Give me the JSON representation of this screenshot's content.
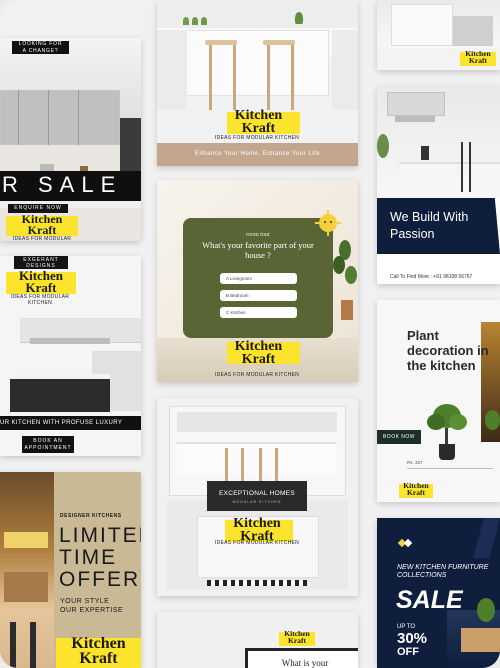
{
  "brand": {
    "name": "Kitchen Kraft",
    "name_line1": "Kitchen",
    "name_line2": "Kraft",
    "tagline": "IDEAS FOR MODULAR KITCHEN"
  },
  "col1": {
    "tile1": {
      "top_label_1": "LOOKING FOR",
      "top_label_2": "A CHANGE?",
      "sale_text": "R SALE",
      "enquire": "ENQUIRE NOW"
    },
    "tile2": {
      "label_1": "EXGERANT",
      "label_2": "DESIGNS",
      "bottom_text": "UR KITCHEN  WITH PROFUSE LUXURY",
      "book_1": "BOOK AN",
      "book_2": "APPOINTMENT"
    },
    "tile3": {
      "small": "DESIGNER KITCHENS",
      "headline_1": "LIMITED",
      "headline_2": "TIME",
      "headline_3": "OFFER",
      "sub_1": "YOUR STYLE",
      "sub_2": "OUR EXPERTISE"
    }
  },
  "col2": {
    "tile1": {
      "caption": "Enhance Your Home, Enhance Your Life"
    },
    "tile2": {
      "room_tour": "room tour",
      "question": "What's your favorite part of your house ?",
      "options": [
        "A  Livingroom",
        "B  Bedroom",
        "C  Kitchen"
      ]
    },
    "tile3": {
      "banner": "EXCEPTIONAL HOMES",
      "banner_sub": "MODULAR KITCHEN"
    },
    "tile4": {
      "question": "What is your"
    }
  },
  "col3": {
    "tile2": {
      "headline_1": "We Build With",
      "headline_2": "Passion",
      "phone": "Call To Find More : +91 98108 56767"
    },
    "tile3": {
      "headline_1": "Plant",
      "headline_2": "decoration in",
      "headline_3": "the kitchen",
      "book": "BOOK NOW",
      "price": "Rs. 337"
    },
    "tile4": {
      "line1": "NEW KITCHEN FURNITURE",
      "line2": "COLLECTIONS",
      "sale": "SALE",
      "upto": "UP TO",
      "percent": "30%",
      "off": "OFF"
    }
  },
  "colors": {
    "yellow": "#fbe42b",
    "olive": "#5a6536",
    "navy": "#0f1e3d",
    "tan": "#c2a68d",
    "khaki": "#c9b995"
  }
}
